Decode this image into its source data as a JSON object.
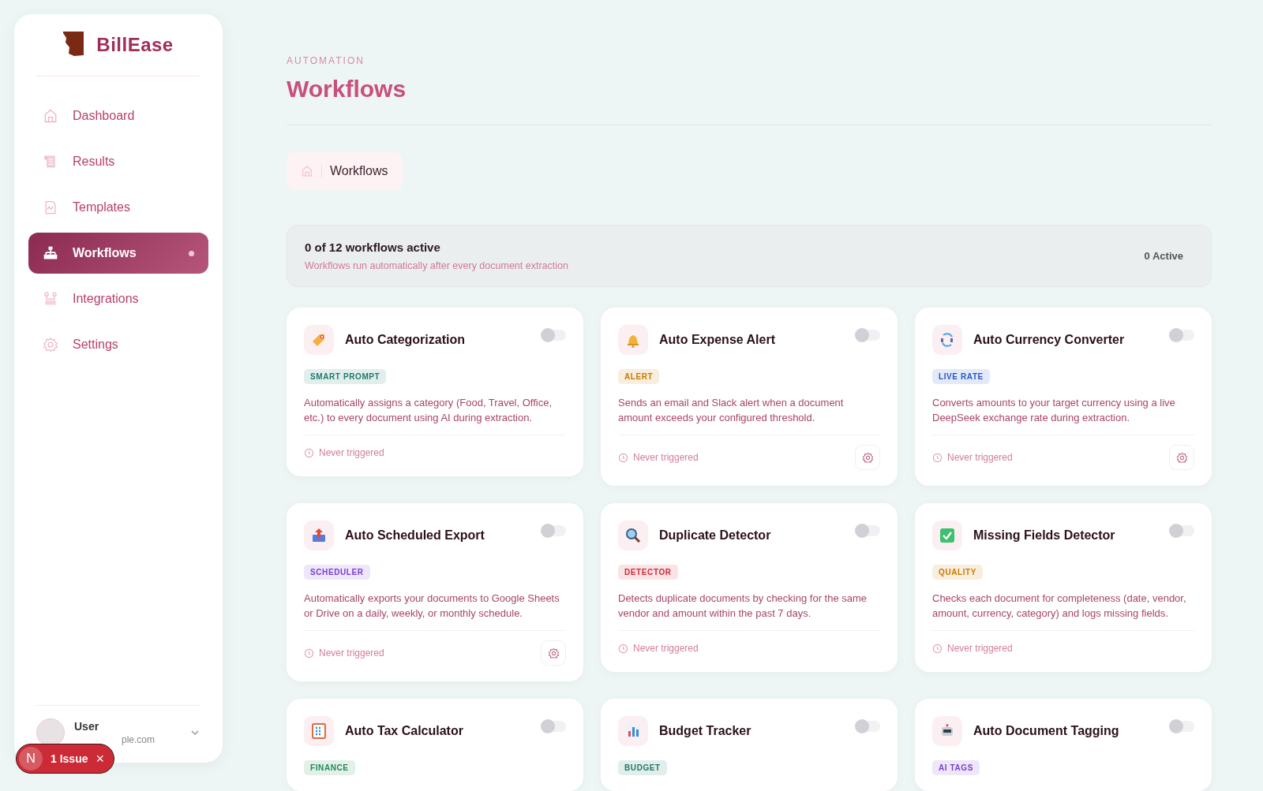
{
  "sidebar": {
    "brand": "BillEase",
    "items": [
      {
        "label": "Dashboard",
        "selected": false
      },
      {
        "label": "Results",
        "selected": false
      },
      {
        "label": "Templates",
        "selected": false
      },
      {
        "label": "Workflows",
        "selected": true
      },
      {
        "label": "Integrations",
        "selected": false
      },
      {
        "label": "Settings",
        "selected": false
      }
    ],
    "user": {
      "name": "User",
      "email": "ple.com"
    }
  },
  "issue_badge": {
    "letter": "N",
    "label": "1 Issue",
    "close": "×"
  },
  "header": {
    "eyebrow": "AUTOMATION",
    "title": "Workflows"
  },
  "breadcrumb": {
    "label": "Workflows"
  },
  "summary": {
    "title": "0 of 12 workflows active",
    "subtitle": "Workflows run automatically after every document extraction",
    "count": "0 Active"
  },
  "workflows": [
    {
      "title": "Auto Categorization",
      "tag": "SMART PROMPT",
      "color": "#1f7a6b",
      "description": "Automatically assigns a category (Food, Travel, Office, etc.) to every document using AI during extraction.",
      "status": "Never triggered",
      "on": false,
      "settings": false
    },
    {
      "title": "Auto Expense Alert",
      "tag": "ALERT",
      "color": "#c77a00",
      "description": "Sends an email and Slack alert when a document amount exceeds your configured threshold.",
      "status": "Never triggered",
      "on": false,
      "settings": true
    },
    {
      "title": "Auto Currency Converter",
      "tag": "LIVE RATE",
      "color": "#2458c7",
      "description": "Converts amounts to your target currency using a live DeepSeek exchange rate during extraction.",
      "status": "Never triggered",
      "on": false,
      "settings": true
    },
    {
      "title": "Auto Scheduled Export",
      "tag": "SCHEDULER",
      "color": "#7a3fd1",
      "description": "Automatically exports your documents to Google Sheets or Drive on a daily, weekly, or monthly schedule.",
      "status": "Never triggered",
      "on": false,
      "settings": true
    },
    {
      "title": "Duplicate Detector",
      "tag": "DETECTOR",
      "color": "#d02a3a",
      "description": "Detects duplicate documents by checking for the same vendor and amount within the past 7 days.",
      "status": "Never triggered",
      "on": false,
      "settings": false
    },
    {
      "title": "Missing Fields Detector",
      "tag": "QUALITY",
      "color": "#c77a00",
      "description": "Checks each document for completeness (date, vendor, amount, currency, category) and logs missing fields.",
      "status": "Never triggered",
      "on": false,
      "settings": false
    },
    {
      "title": "Auto Tax Calculator",
      "tag": "FINANCE",
      "color": "#1f8a55",
      "on": false
    },
    {
      "title": "Budget Tracker",
      "tag": "BUDGET",
      "color": "#1f7a6b",
      "on": false
    },
    {
      "title": "Auto Document Tagging",
      "tag": "AI TAGS",
      "color": "#7a3fd1",
      "on": false
    }
  ]
}
